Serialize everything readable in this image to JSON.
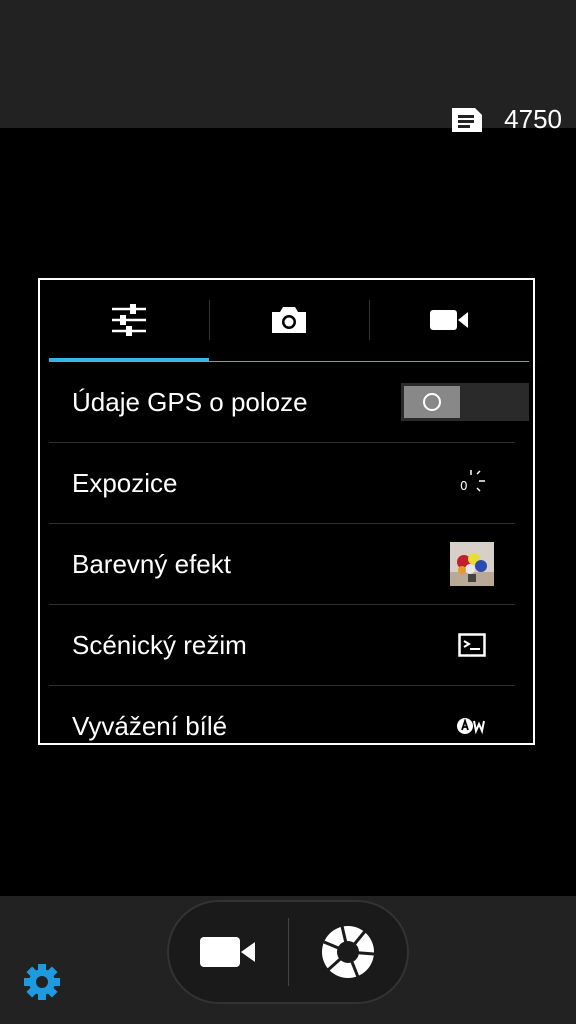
{
  "status": {
    "remaining_shots": "4750",
    "icon": "memory-card-icon"
  },
  "tabs": [
    {
      "name": "sliders-icon",
      "active": true
    },
    {
      "name": "camera-icon",
      "active": false
    },
    {
      "name": "video-camera-icon",
      "active": false
    }
  ],
  "settings": [
    {
      "label": "Údaje GPS o poloze",
      "control": "toggle",
      "state": "off"
    },
    {
      "label": "Expozice",
      "value": "0",
      "icon": "exposure-icon"
    },
    {
      "label": "Barevný efekt",
      "icon": "color-effect-thumbnail"
    },
    {
      "label": "Scénický režim",
      "icon": "scene-mode-icon"
    },
    {
      "label": "Vyvážení bílé",
      "icon": "auto-white-balance-icon"
    }
  ],
  "bottom": {
    "video_button": "video-camera-icon",
    "shutter_button": "shutter-icon",
    "settings_button": "gear-icon"
  },
  "colors": {
    "accent": "#33b5e5",
    "gear": "#1e9ae0"
  }
}
